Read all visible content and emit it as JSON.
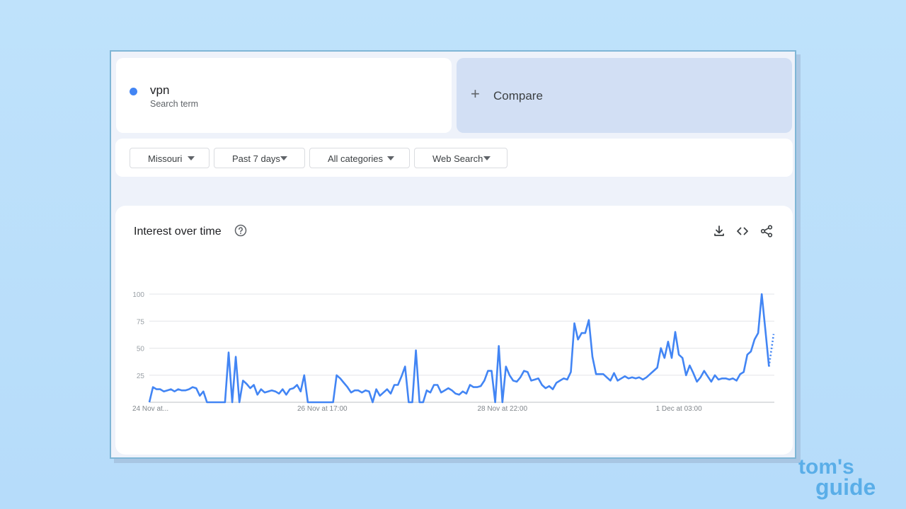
{
  "search_term": {
    "name": "vpn",
    "subtitle": "Search term",
    "color": "#4285f4"
  },
  "compare": {
    "label": "Compare"
  },
  "filters": [
    {
      "label": "Missouri"
    },
    {
      "label": "Past 7 days"
    },
    {
      "label": "All categories"
    },
    {
      "label": "Web Search"
    }
  ],
  "chart": {
    "title": "Interest over time",
    "icons": [
      "help-icon",
      "download-icon",
      "embed-code-icon",
      "share-icon"
    ]
  },
  "watermark": {
    "line1": "tom's",
    "line2": "guide"
  },
  "chart_data": {
    "type": "line",
    "title": "Interest over time",
    "xlabel": "",
    "ylabel": "",
    "ylim": [
      0,
      100
    ],
    "yticks": [
      25,
      50,
      75,
      100
    ],
    "grid": true,
    "color": "#4285f4",
    "x_tick_labels": [
      {
        "index": 0,
        "label": "24 Nov at..."
      },
      {
        "index": 48,
        "label": "26 Nov at 17:00"
      },
      {
        "index": 98,
        "label": "28 Nov at 22:00"
      },
      {
        "index": 147,
        "label": "1 Dec at 03:00"
      }
    ],
    "partial_from_index": 155,
    "series": [
      {
        "values": [
          0,
          14,
          12,
          12,
          10,
          11,
          12,
          10,
          12,
          11,
          11,
          12,
          14,
          13,
          6,
          10,
          0,
          0,
          0,
          0,
          0,
          0,
          46,
          0,
          42,
          0,
          20,
          17,
          13,
          16,
          7,
          12,
          9,
          10,
          11,
          10,
          8,
          12,
          7,
          12,
          13,
          16,
          10,
          25,
          0,
          0,
          0,
          0,
          0,
          0,
          0,
          0,
          25,
          22,
          18,
          14,
          9,
          11,
          11,
          9,
          11,
          10,
          0,
          12,
          6,
          9,
          12,
          8,
          16,
          16,
          24,
          33,
          0,
          0,
          48,
          0,
          0,
          11,
          9,
          16,
          16,
          9,
          11,
          13,
          11,
          8,
          7,
          10,
          8,
          16,
          14,
          14,
          15,
          20,
          29,
          29,
          0,
          52,
          0,
          33,
          25,
          20,
          19,
          23,
          29,
          28,
          20,
          21,
          22,
          16,
          13,
          15,
          12,
          18,
          20,
          22,
          21,
          28,
          73,
          58,
          64,
          64,
          76,
          42,
          26,
          26,
          26,
          23,
          20,
          27,
          20,
          22,
          24,
          22,
          23,
          22,
          23,
          21,
          23,
          26,
          29,
          32,
          50,
          41,
          56,
          41,
          65,
          44,
          41,
          25,
          34,
          27,
          19,
          23,
          29,
          24,
          19,
          25,
          21,
          22,
          22,
          21,
          22,
          20,
          26,
          28,
          44,
          47,
          58,
          64,
          100,
          67,
          33
        ],
        "partial_tail": [
          33,
          63
        ]
      }
    ]
  }
}
